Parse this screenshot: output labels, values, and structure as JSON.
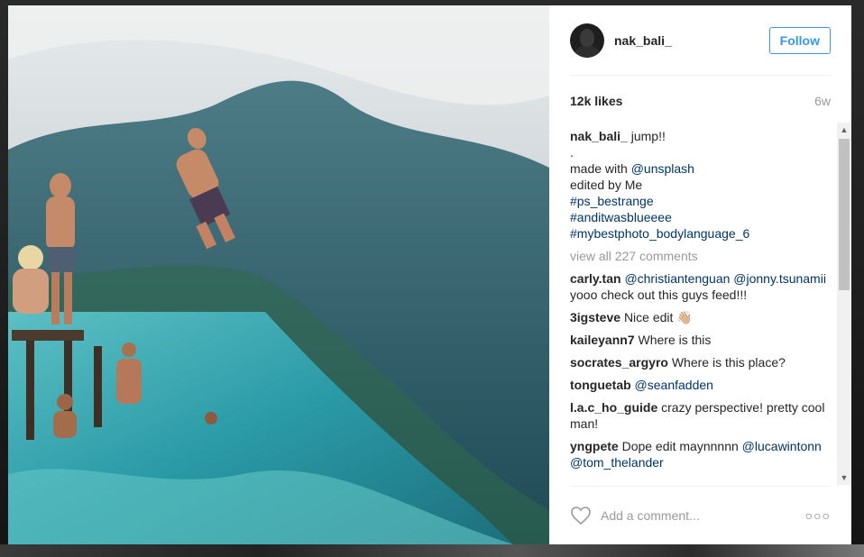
{
  "post": {
    "username": "nak_bali_",
    "follow_label": "Follow",
    "likes": "12k likes",
    "age": "6w"
  },
  "caption": {
    "user": "nak_bali_",
    "text": "jump!!",
    "line_dot": ".",
    "made_with": "made with",
    "mention": "@unsplash",
    "edited_by": "edited by Me",
    "tags": [
      "#ps_bestrange",
      "#anditwasblueeee",
      "#mybestphoto_bodylanguage_6"
    ]
  },
  "view_all": "view all 227 comments",
  "comments": [
    {
      "user": "carly.tan",
      "mention": "@christiantenguan",
      "mention2": "@jonny.tsunamii",
      "text": " yooo check out this guys feed!!!"
    },
    {
      "user": "3igsteve",
      "text": "Nice edit 👋🏼"
    },
    {
      "user": "kaileyann7",
      "text": "Where is this"
    },
    {
      "user": "socrates_argyro",
      "text": "Where is this place?"
    },
    {
      "user": "tonguetab",
      "mention": "@seanfadden"
    },
    {
      "user": "l.a.c_ho_guide",
      "text": "crazy perspective! pretty cool man!"
    },
    {
      "user": "yngpete",
      "text": "Dope edit maynnnnn",
      "mention": "@lucawintonn",
      "mention2": "@tom_thelander"
    }
  ],
  "footer": {
    "placeholder": "Add a comment...",
    "more": "○○○"
  },
  "icons": {
    "heart": "heart-icon",
    "more": "more-options-icon",
    "scroll_up": "scroll-up-arrow-icon",
    "scroll_down": "scroll-down-arrow-icon"
  },
  "colors": {
    "link": "#003569",
    "follow": "#3897f0",
    "muted": "#999999"
  }
}
